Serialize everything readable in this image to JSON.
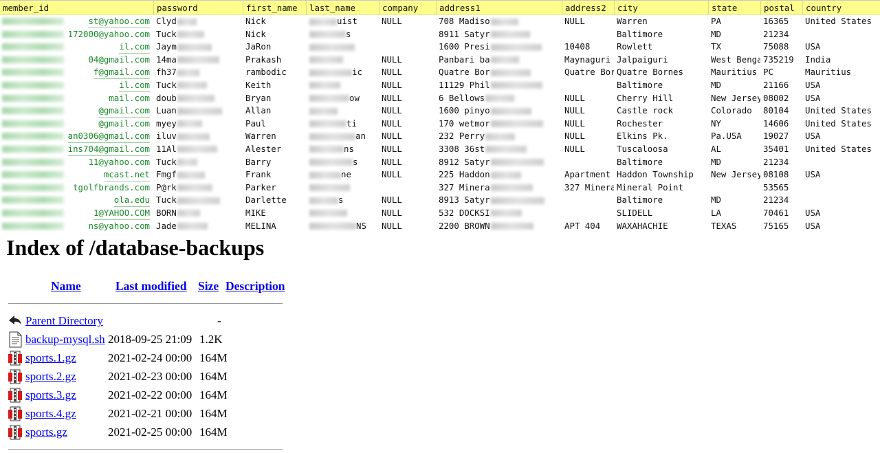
{
  "table": {
    "columns": [
      "member_id",
      "password",
      "first_name",
      "last_name",
      "company",
      "address1",
      "address2",
      "city",
      "state",
      "postal",
      "country"
    ],
    "rows": [
      {
        "member_id": "st@yahoo.com",
        "password": "Clyd",
        "first_name": "Nick",
        "last_name": "uist",
        "company": "NULL",
        "address1": "708 Madiso",
        "address2": "NULL",
        "city": "Warren",
        "state": "PA",
        "postal": "16365",
        "country": "United States"
      },
      {
        "member_id": "172000@yahoo.com",
        "password": "Tuck",
        "first_name": "Nick",
        "last_name": "s",
        "company": "",
        "address1": "8911 Satyr",
        "address2": "",
        "city": "Baltimore",
        "state": "MD",
        "postal": "21234",
        "country": ""
      },
      {
        "member_id": "il.com",
        "password": "Jaym",
        "first_name": "JaRon",
        "last_name": "",
        "company": "",
        "address1": "1600 Presi",
        "address2": "10408",
        "city": "Rowlett",
        "state": "TX",
        "postal": "75088",
        "country": "USA"
      },
      {
        "member_id": "04@gmail.com",
        "password": "14ma",
        "first_name": "Prakash",
        "last_name": "",
        "company": "NULL",
        "address1": "Panbari ba",
        "address2": "Maynaguri",
        "city": "Jalpaiguri",
        "state": "West Benga",
        "postal": "735219",
        "country": "India"
      },
      {
        "member_id": "f@gmail.com",
        "password": "fh37",
        "first_name": "rambodic",
        "last_name": "ic",
        "company": "NULL",
        "address1": "Quatre Bor",
        "address2": "Quatre Bor",
        "city": "Quatre Bornes",
        "state": "Mauritius",
        "postal": "PC",
        "country": "Mauritius"
      },
      {
        "member_id": "il.com",
        "password": "Tuck",
        "first_name": "Keith",
        "last_name": "",
        "company": "NULL",
        "address1": "11129 Phil",
        "address2": "",
        "city": "Baltimore",
        "state": "MD",
        "postal": "21166",
        "country": "USA"
      },
      {
        "member_id": "mail.com",
        "password": "doub",
        "first_name": "Bryan",
        "last_name": "ow",
        "company": "NULL",
        "address1": "6 Bellows",
        "address2": "NULL",
        "city": "Cherry Hill",
        "state": "New Jersey",
        "postal": "08002",
        "country": "USA"
      },
      {
        "member_id": "@gmail.com",
        "password": "Luan",
        "first_name": "Allan",
        "last_name": "",
        "company": "NULL",
        "address1": "1600 pinyo",
        "address2": "NULL",
        "city": "Castle rock",
        "state": "Colorado",
        "postal": "80104",
        "country": "United States"
      },
      {
        "member_id": "@gmail.com",
        "password": "myey",
        "first_name": "Paul",
        "last_name": "ti",
        "company": "NULL",
        "address1": "170 wetmor",
        "address2": "NULL",
        "city": "Rochester",
        "state": "NY",
        "postal": "14606",
        "country": "United States"
      },
      {
        "member_id": "an0306@gmail.com",
        "password": "iluv",
        "first_name": "Warren",
        "last_name": "an",
        "company": "NULL",
        "address1": "232 Perry",
        "address2": "NULL",
        "city": "Elkins Pk.",
        "state": "Pa.USA",
        "postal": "19027",
        "country": "USA"
      },
      {
        "member_id": "ins704@gmail.com",
        "password": "11Al",
        "first_name": "Alester",
        "last_name": "ns",
        "company": "NULL",
        "address1": "3308 36st",
        "address2": "NULL",
        "city": "Tuscaloosa",
        "state": "AL",
        "postal": "35401",
        "country": "United States"
      },
      {
        "member_id": "11@yahoo.com",
        "password": "Tuck",
        "first_name": "Barry",
        "last_name": "s",
        "company": "NULL",
        "address1": "8912 Satyr",
        "address2": "",
        "city": "Baltimore",
        "state": "MD",
        "postal": "21234",
        "country": ""
      },
      {
        "member_id": "mcast.net",
        "password": "Fmgf",
        "first_name": "Frank",
        "last_name": "ne",
        "company": "NULL",
        "address1": "225 Haddon",
        "address2": "Apartment",
        "city": "Haddon Township",
        "state": "New Jersey",
        "postal": "08108",
        "country": "USA"
      },
      {
        "member_id": "tgolfbrands.com",
        "password": "P@rk",
        "first_name": "Parker",
        "last_name": "",
        "company": "",
        "address1": "327 Minera",
        "address2": "327 Minera",
        "city": "Mineral Point",
        "state": "",
        "postal": "53565",
        "country": ""
      },
      {
        "member_id": "ola.edu",
        "password": "Tuck",
        "first_name": "Darlette",
        "last_name": "s",
        "company": "NULL",
        "address1": "8913 Satyr",
        "address2": "",
        "city": "Baltimore",
        "state": "MD",
        "postal": "21234",
        "country": ""
      },
      {
        "member_id": "1@YAHOO.COM",
        "password": "BORN",
        "first_name": "MIKE",
        "last_name": "",
        "company": "NULL",
        "address1": "532 DOCKSI",
        "address2": "",
        "city": "SLIDELL",
        "state": "LA",
        "postal": "70461",
        "country": "USA"
      },
      {
        "member_id": "ns@yahoo.com",
        "password": "Jade",
        "first_name": "MELINA",
        "last_name": "NS",
        "company": "NULL",
        "address1": "2200 BROWN",
        "address2": "APT 404",
        "city": "WAXAHACHIE",
        "state": "TEXAS",
        "postal": "75165",
        "country": "USA"
      }
    ]
  },
  "listing": {
    "title": "Index of /database-backups",
    "headers": {
      "name": "Name",
      "last_modified": "Last modified",
      "size": "Size",
      "description": "Description"
    },
    "entries": [
      {
        "icon": "back-icon",
        "name": "Parent Directory",
        "modified": "",
        "size": "-"
      },
      {
        "icon": "text-file-icon",
        "name": "backup-mysql.sh",
        "modified": "2018-09-25 21:09",
        "size": "1.2K"
      },
      {
        "icon": "archive-icon",
        "name": "sports.1.gz",
        "modified": "2021-02-24 00:00",
        "size": "164M"
      },
      {
        "icon": "archive-icon",
        "name": "sports.2.gz",
        "modified": "2021-02-23 00:00",
        "size": "164M"
      },
      {
        "icon": "archive-icon",
        "name": "sports.3.gz",
        "modified": "2021-02-22 00:00",
        "size": "164M"
      },
      {
        "icon": "archive-icon",
        "name": "sports.4.gz",
        "modified": "2021-02-21 00:00",
        "size": "164M"
      },
      {
        "icon": "archive-icon",
        "name": "sports.gz",
        "modified": "2021-02-25 00:00",
        "size": "164M"
      }
    ]
  },
  "colors": {
    "header_bg": "#fdfd8c",
    "email_green": "#1a8a2a",
    "link_blue": "#0000ee"
  }
}
